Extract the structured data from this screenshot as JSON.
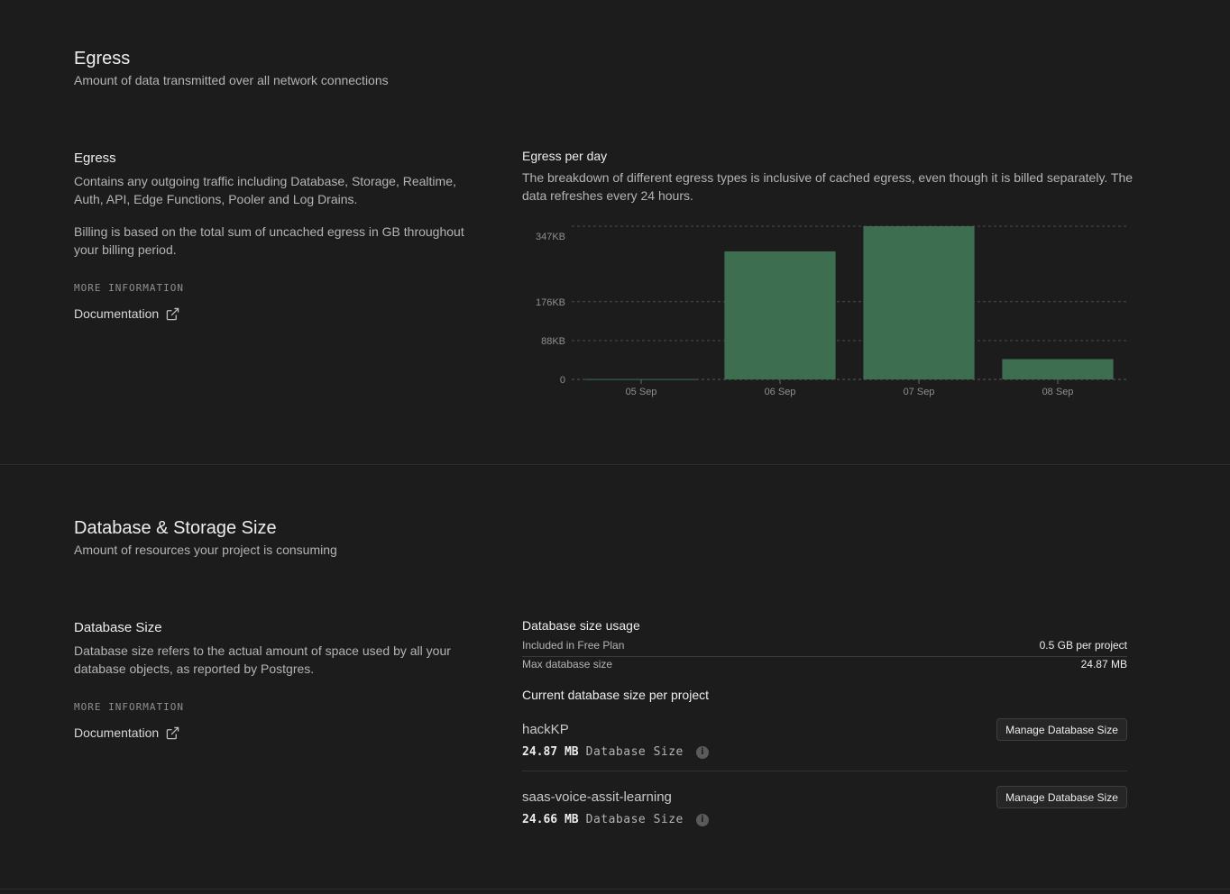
{
  "egress": {
    "title": "Egress",
    "subtitle": "Amount of data transmitted over all network connections",
    "info": {
      "title": "Egress",
      "para1": "Contains any outgoing traffic including Database, Storage, Realtime, Auth, API, Edge Functions, Pooler and Log Drains.",
      "para2": "Billing is based on the total sum of uncached egress in GB throughout your billing period.",
      "more_info_label": "MORE INFORMATION",
      "doc_link": "Documentation",
      "doc_icon": "external-link-icon"
    },
    "chart_panel": {
      "title": "Egress per day",
      "description": "The breakdown of different egress types is inclusive of cached egress, even though it is billed separately. The data refreshes every 24 hours."
    }
  },
  "chart_data": {
    "type": "bar",
    "categories": [
      "05 Sep",
      "06 Sep",
      "07 Sep",
      "08 Sep"
    ],
    "values": [
      0.8,
      290,
      347,
      46
    ],
    "unit": "KB",
    "ylim": [
      0,
      347
    ],
    "ytick_values": [
      0,
      88,
      176,
      347
    ],
    "ytick_labels": [
      "0",
      "88KB",
      "176KB",
      "347KB"
    ],
    "grid": true,
    "bar_color": "#3c6e4f"
  },
  "database": {
    "title": "Database & Storage Size",
    "subtitle": "Amount of resources your project is consuming",
    "info": {
      "title": "Database Size",
      "para1": "Database size refers to the actual amount of space used by all your database objects, as reported by Postgres.",
      "more_info_label": "MORE INFORMATION",
      "doc_link": "Documentation",
      "doc_icon": "external-link-icon"
    },
    "usage": {
      "title": "Database size usage",
      "rows": [
        {
          "label": "Included in Free Plan",
          "value": "0.5 GB per project"
        },
        {
          "label": "Max database size",
          "value": "24.87 MB"
        }
      ]
    },
    "per_project_title": "Current database size per project",
    "projects": [
      {
        "name": "hackKP",
        "size": "24.87 MB",
        "size_label": "Database Size",
        "button": "Manage Database Size"
      },
      {
        "name": "saas-voice-assit-learning",
        "size": "24.66 MB",
        "size_label": "Database Size",
        "button": "Manage Database Size"
      }
    ]
  }
}
